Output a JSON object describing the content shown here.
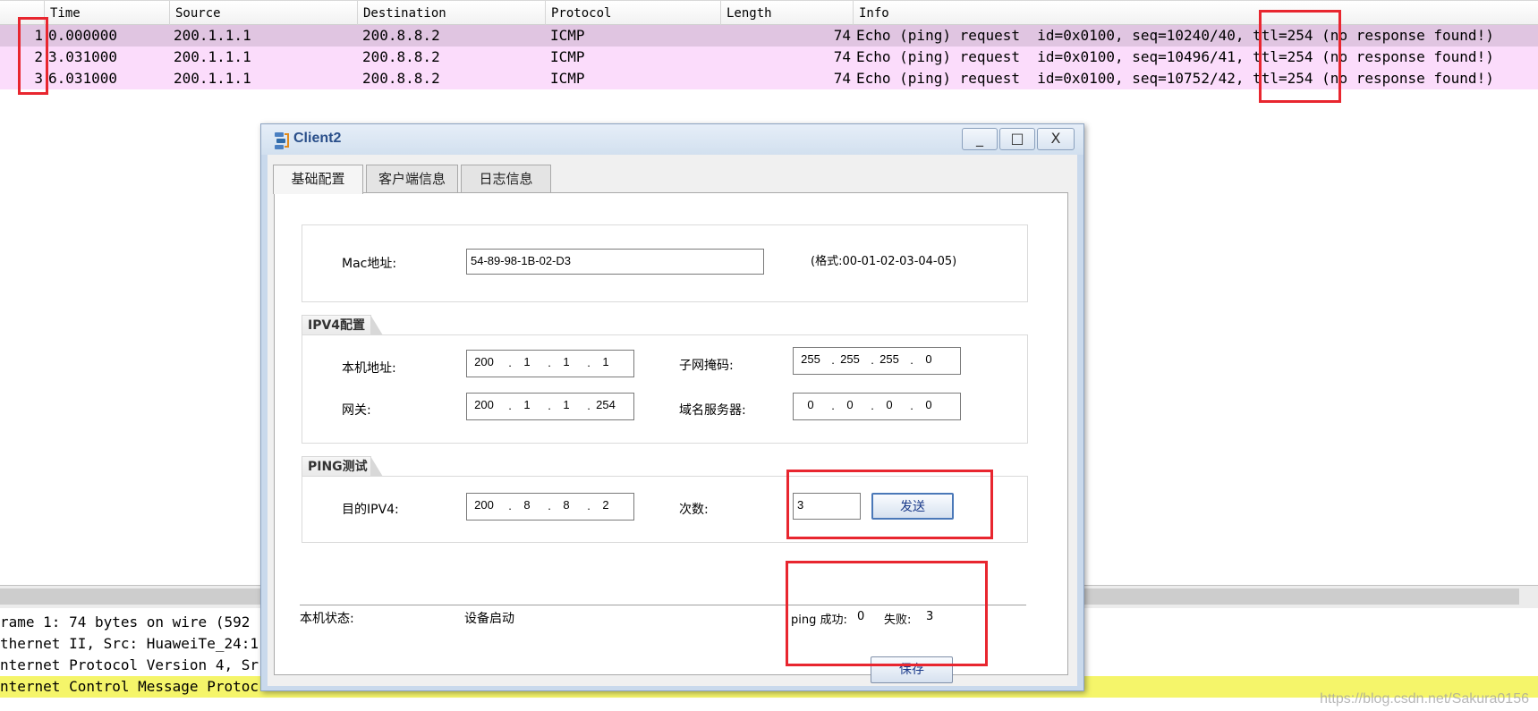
{
  "packet_list": {
    "columns": [
      "",
      "Time",
      "Source",
      "Destination",
      "Protocol",
      "Length",
      "Info"
    ],
    "rows": [
      {
        "no": "1",
        "time": "0.000000",
        "source": "200.1.1.1",
        "destination": "200.8.8.2",
        "protocol": "ICMP",
        "length": "74",
        "info": "Echo (ping) request  id=0x0100, seq=10240/40, ttl=254 (no response found!)"
      },
      {
        "no": "2",
        "time": "3.031000",
        "source": "200.1.1.1",
        "destination": "200.8.8.2",
        "protocol": "ICMP",
        "length": "74",
        "info": "Echo (ping) request  id=0x0100, seq=10496/41, ttl=254 (no response found!)"
      },
      {
        "no": "3",
        "time": "6.031000",
        "source": "200.1.1.1",
        "destination": "200.8.8.2",
        "protocol": "ICMP",
        "length": "74",
        "info": "Echo (ping) request  id=0x0100, seq=10752/42, ttl=254 (no response found!)"
      }
    ]
  },
  "detail_pane": {
    "lines": [
      "rame 1: 74 bytes on wire (592",
      "thernet II, Src: HuaweiTe_24:1",
      "nternet Protocol Version 4, Sr",
      "nternet Control Message Protoc"
    ]
  },
  "dialog": {
    "title": "Client2",
    "icon": "client-app-icon",
    "window_buttons": {
      "minimize": "_",
      "maximize": "□",
      "close": "X"
    },
    "tabs": [
      "基础配置",
      "客户端信息",
      "日志信息"
    ],
    "active_tab": "基础配置",
    "mac": {
      "label": "Mac地址:",
      "value": "54-89-98-1B-02-D3",
      "format_hint": "(格式:00-01-02-03-04-05)"
    },
    "ipv4": {
      "title": "IPV4配置",
      "host_label": "本机地址:",
      "host": [
        "200",
        "1",
        "1",
        "1"
      ],
      "mask_label": "子网掩码:",
      "mask": [
        "255",
        "255",
        "255",
        "0"
      ],
      "gateway_label": "网关:",
      "gateway": [
        "200",
        "1",
        "1",
        "254"
      ],
      "dns_label": "域名服务器:",
      "dns": [
        "0",
        "0",
        "0",
        "0"
      ]
    },
    "ping": {
      "title": "PING测试",
      "dest_label": "目的IPV4:",
      "dest": [
        "200",
        "8",
        "8",
        "2"
      ],
      "count_label": "次数:",
      "count": "3",
      "send_button": "发送"
    },
    "status": {
      "label": "本机状态:",
      "value": "设备启动",
      "success_label": "ping 成功:",
      "success": "0",
      "fail_label": "失败:",
      "fail": "3",
      "save_button": "保存"
    }
  },
  "watermark": "https://blog.csdn.net/Sakura0156",
  "colors": {
    "row_bg": "#fbdcfb",
    "row_selected": "#e0c5e1",
    "annotation": "#e8262f",
    "highlight": "#f5f56a"
  }
}
